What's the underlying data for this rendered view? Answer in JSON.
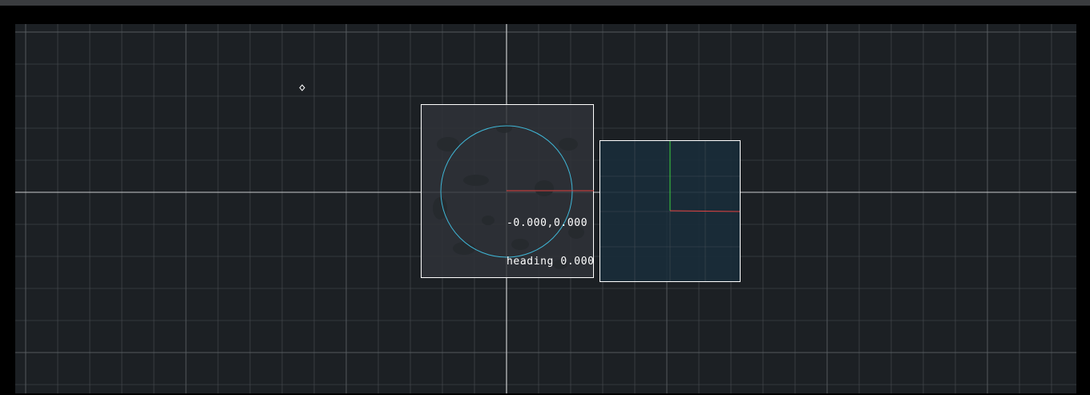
{
  "viewport": {
    "readout": {
      "position_text": "-0.000,0.000",
      "heading_text": "heading 0.000"
    },
    "colors": {
      "background": "#1c2024",
      "grid": "#5a5f64",
      "axis": "#c8cacc",
      "footprint_fill": "#2f3338",
      "footprint_border": "#ffffff",
      "circle": "#3fb6d6",
      "sensor_fill": "#1a2c3a",
      "axis_x": "#e0403f",
      "axis_y": "#3ccf3c"
    },
    "objects": [
      {
        "name": "robot-footprint",
        "shape": "square"
      },
      {
        "name": "robot-body-circle",
        "shape": "circle"
      },
      {
        "name": "sensor-frame",
        "shape": "square"
      },
      {
        "name": "waypoint-marker",
        "shape": "diamond"
      }
    ]
  }
}
